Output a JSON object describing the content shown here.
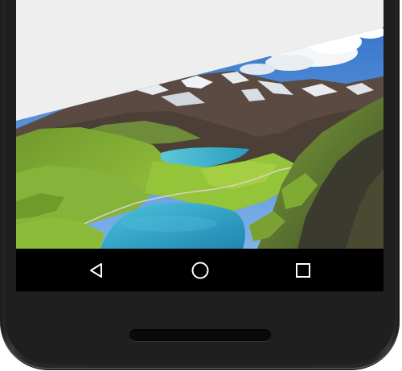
{
  "device": {
    "model": "android-phone",
    "body_color": "#222222",
    "screen_background": "#eeeeee"
  },
  "wallpaper": {
    "subject": "alpine-lake-landscape",
    "sky_color": "#3f7fd0",
    "lake_color": "#2f9ec4",
    "grass_color": "#8fc23a",
    "rock_color": "#4a4038"
  },
  "navbar": {
    "background": "#000000",
    "icon_color": "#ffffff",
    "buttons": [
      {
        "name": "back",
        "icon": "triangle-back-icon"
      },
      {
        "name": "home",
        "icon": "circle-home-icon"
      },
      {
        "name": "recents",
        "icon": "square-recents-icon"
      }
    ]
  },
  "speaker": {
    "icon": "speaker-grille"
  }
}
